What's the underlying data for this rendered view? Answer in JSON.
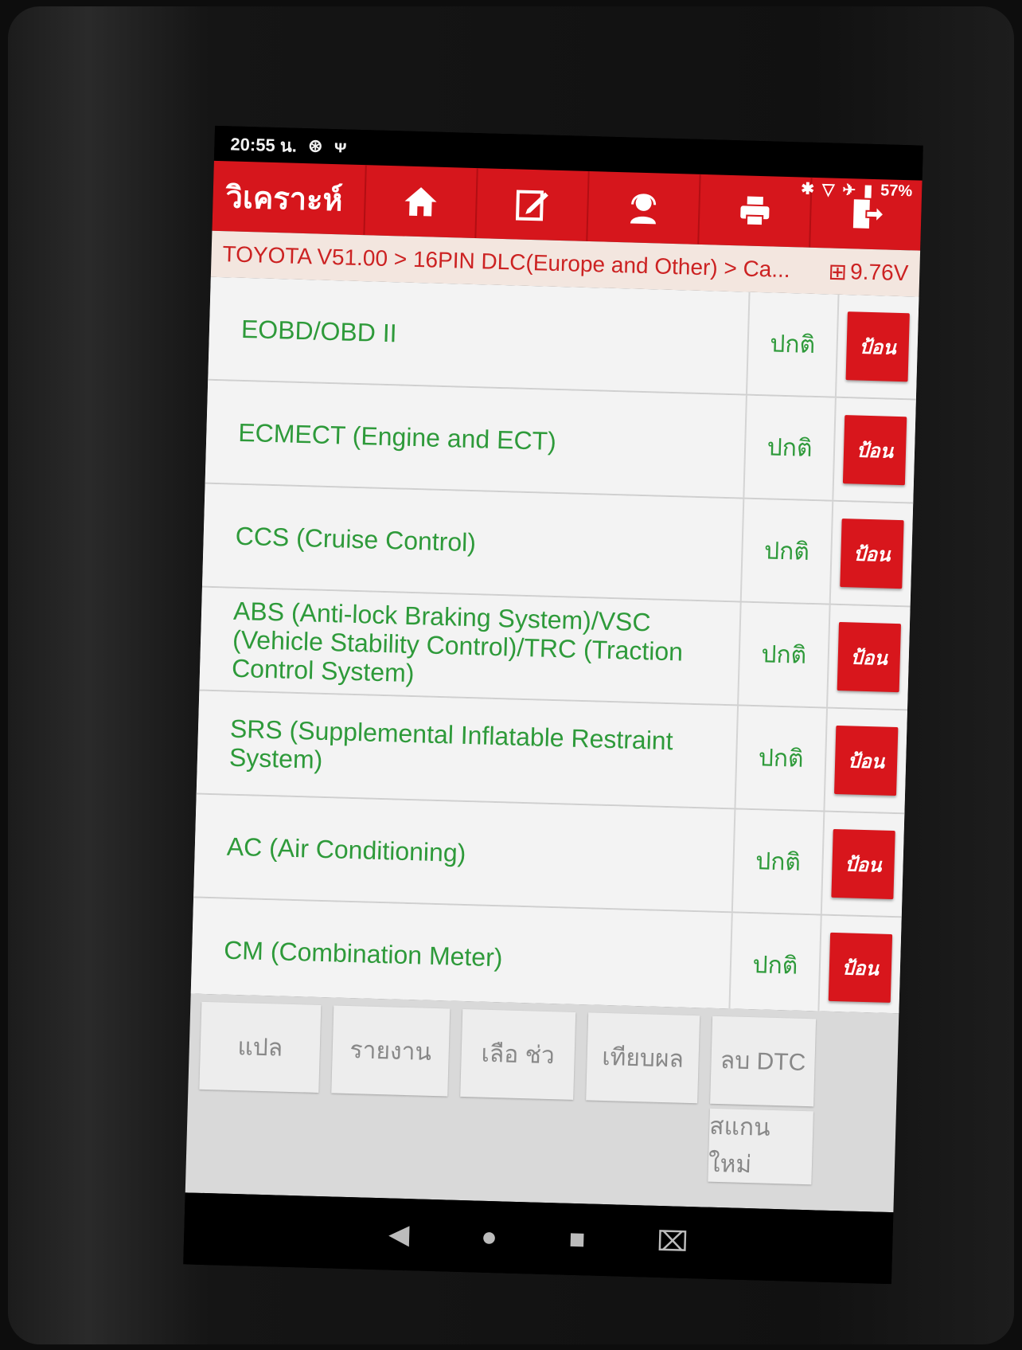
{
  "status_bar": {
    "time": "20:55 น.",
    "battery": "57%"
  },
  "app_header": {
    "title": "วิเคราะห์",
    "toolbar": [
      {
        "icon": "home-icon"
      },
      {
        "icon": "edit-icon"
      },
      {
        "icon": "support-icon"
      },
      {
        "icon": "printer-icon"
      },
      {
        "icon": "exit-icon"
      }
    ]
  },
  "breadcrumb": {
    "text": "TOYOTA V51.00 > 16PIN DLC(Europe and Other) > Ca...",
    "voltage": "9.76V"
  },
  "systems": [
    {
      "name": "EOBD/OBD II",
      "status": "ปกติ",
      "action": "ป้อน"
    },
    {
      "name": "ECMECT (Engine and ECT)",
      "status": "ปกติ",
      "action": "ป้อน"
    },
    {
      "name": "CCS (Cruise Control)",
      "status": "ปกติ",
      "action": "ป้อน"
    },
    {
      "name": "ABS (Anti-lock Braking System)/VSC (Vehicle Stability Control)/TRC (Traction Control System)",
      "status": "ปกติ",
      "action": "ป้อน"
    },
    {
      "name": "SRS (Supplemental Inflatable Restraint System)",
      "status": "ปกติ",
      "action": "ป้อน"
    },
    {
      "name": "AC (Air Conditioning)",
      "status": "ปกติ",
      "action": "ป้อน"
    },
    {
      "name": "CM (Combination Meter)",
      "status": "ปกติ",
      "action": "ป้อน"
    }
  ],
  "actions": {
    "translate": "แปล",
    "report": "รายงาน",
    "help": "เลือ ช่ว",
    "compare": "เทียบผล",
    "clear_dtc": "ลบ DTC",
    "rescan": "สแกนใหม่"
  },
  "colors": {
    "brand_red": "#d6161c",
    "ok_green": "#2e9a3a"
  }
}
